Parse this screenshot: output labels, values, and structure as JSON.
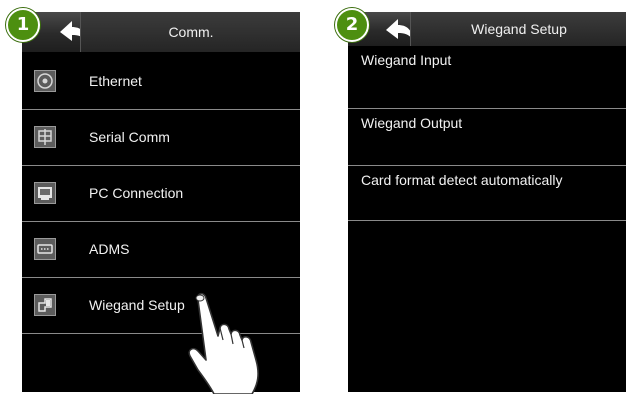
{
  "screen1": {
    "step_number": "1",
    "title": "Comm.",
    "menu": [
      {
        "label": "Ethernet",
        "icon": "ethernet-icon"
      },
      {
        "label": "Serial Comm",
        "icon": "serial-comm-icon"
      },
      {
        "label": "PC Connection",
        "icon": "pc-connection-icon"
      },
      {
        "label": "ADMS",
        "icon": "adms-icon"
      },
      {
        "label": "Wiegand Setup",
        "icon": "wiegand-setup-icon"
      }
    ]
  },
  "screen2": {
    "step_number": "2",
    "title": "Wiegand Setup",
    "items": [
      {
        "label": "Wiegand Input"
      },
      {
        "label": "Wiegand Output"
      },
      {
        "label": "Card format detect automatically"
      }
    ]
  },
  "colors": {
    "badge_green": "#4d8f10",
    "screen_bg": "#000000",
    "divider": "#8a8a8a"
  }
}
